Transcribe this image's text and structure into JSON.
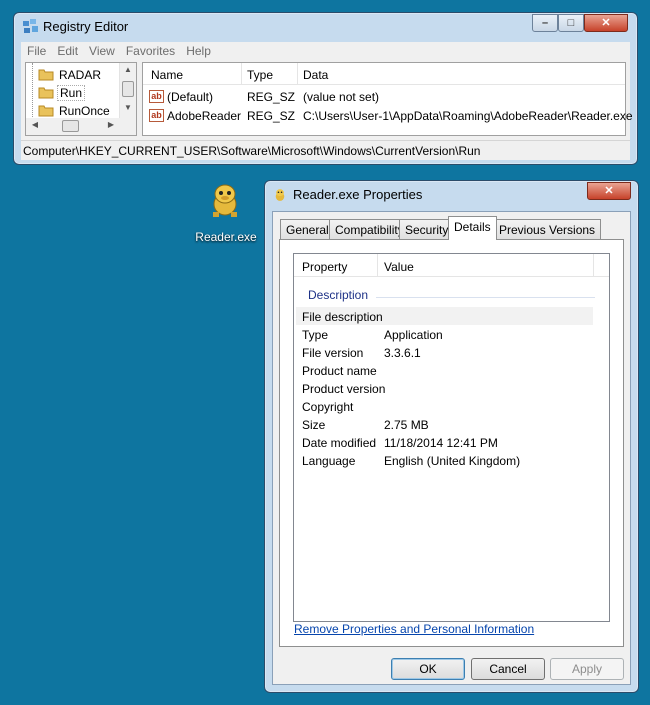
{
  "registry": {
    "title": "Registry Editor",
    "menu": [
      "File",
      "Edit",
      "View",
      "Favorites",
      "Help"
    ],
    "tree": [
      "RADAR",
      "Run",
      "RunOnce"
    ],
    "columns": [
      "Name",
      "Type",
      "Data"
    ],
    "rows": [
      {
        "name": "(Default)",
        "type": "REG_SZ",
        "data": "(value not set)"
      },
      {
        "name": "AdobeReader",
        "type": "REG_SZ",
        "data": "C:\\Users\\User-1\\AppData\\Roaming\\AdobeReader\\Reader.exe"
      }
    ],
    "status_path": "Computer\\HKEY_CURRENT_USER\\Software\\Microsoft\\Windows\\CurrentVersion\\Run"
  },
  "desktop": {
    "icon_label": "Reader.exe",
    "icon_name": "reader-app-icon"
  },
  "properties": {
    "title": "Reader.exe Properties",
    "tabs": [
      "General",
      "Compatibility",
      "Security",
      "Details",
      "Previous Versions"
    ],
    "active_tab": "Details",
    "columns": [
      "Property",
      "Value"
    ],
    "group": "Description",
    "rows": [
      {
        "property": "File description",
        "value": ""
      },
      {
        "property": "Type",
        "value": "Application"
      },
      {
        "property": "File version",
        "value": "3.3.6.1"
      },
      {
        "property": "Product name",
        "value": ""
      },
      {
        "property": "Product version",
        "value": ""
      },
      {
        "property": "Copyright",
        "value": ""
      },
      {
        "property": "Size",
        "value": "2.75 MB"
      },
      {
        "property": "Date modified",
        "value": "11/18/2014 12:41 PM"
      },
      {
        "property": "Language",
        "value": "English (United Kingdom)"
      }
    ],
    "link": "Remove Properties and Personal Information",
    "buttons": {
      "ok": "OK",
      "cancel": "Cancel",
      "apply": "Apply"
    }
  },
  "colors": {
    "desktop": "#0e75a0",
    "window_frame": "#c6dbee",
    "link": "#0645ad",
    "close_button": "#c7422a"
  }
}
